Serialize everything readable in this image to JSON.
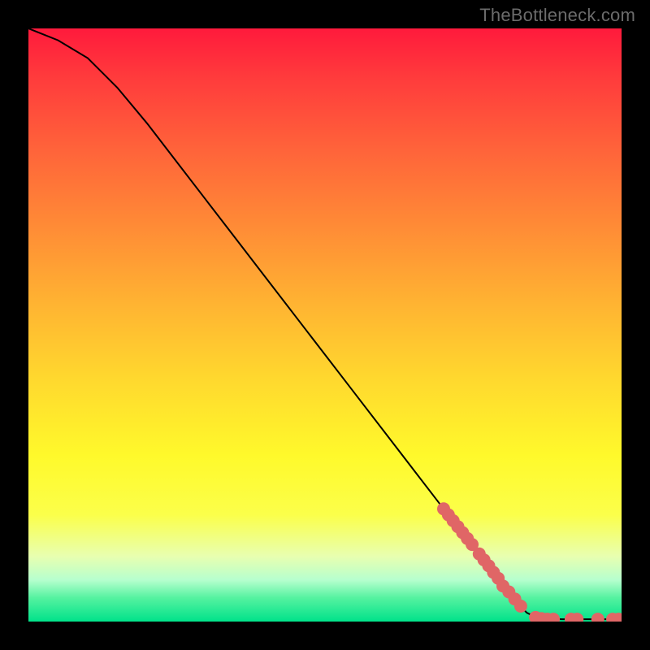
{
  "attribution": "TheBottleneck.com",
  "colors": {
    "dot": "#e06666",
    "curve": "#000000",
    "frame": "#000000"
  },
  "chart_data": {
    "type": "line",
    "title": "",
    "xlabel": "",
    "ylabel": "",
    "xlim": [
      0,
      100
    ],
    "ylim": [
      0,
      100
    ],
    "grid": false,
    "legend": false,
    "curve": [
      {
        "x": 0,
        "y": 100
      },
      {
        "x": 5,
        "y": 98
      },
      {
        "x": 10,
        "y": 95
      },
      {
        "x": 15,
        "y": 90
      },
      {
        "x": 20,
        "y": 84
      },
      {
        "x": 25,
        "y": 77.5
      },
      {
        "x": 30,
        "y": 71
      },
      {
        "x": 35,
        "y": 64.5
      },
      {
        "x": 40,
        "y": 58
      },
      {
        "x": 45,
        "y": 51.5
      },
      {
        "x": 50,
        "y": 45
      },
      {
        "x": 55,
        "y": 38.5
      },
      {
        "x": 60,
        "y": 32
      },
      {
        "x": 65,
        "y": 25.5
      },
      {
        "x": 70,
        "y": 19
      },
      {
        "x": 75,
        "y": 12.5
      },
      {
        "x": 80,
        "y": 6
      },
      {
        "x": 84,
        "y": 1.5
      },
      {
        "x": 86,
        "y": 0.5
      },
      {
        "x": 90,
        "y": 0.4
      },
      {
        "x": 95,
        "y": 0.4
      },
      {
        "x": 100,
        "y": 0.4
      }
    ],
    "highlight_points": [
      {
        "x": 70.0,
        "y": 19.0
      },
      {
        "x": 70.8,
        "y": 18.0
      },
      {
        "x": 71.6,
        "y": 17.0
      },
      {
        "x": 72.4,
        "y": 16.0
      },
      {
        "x": 73.2,
        "y": 15.0
      },
      {
        "x": 74.0,
        "y": 14.0
      },
      {
        "x": 74.8,
        "y": 13.0
      },
      {
        "x": 76.0,
        "y": 11.4
      },
      {
        "x": 76.8,
        "y": 10.4
      },
      {
        "x": 77.6,
        "y": 9.4
      },
      {
        "x": 78.4,
        "y": 8.3
      },
      {
        "x": 79.2,
        "y": 7.3
      },
      {
        "x": 80.0,
        "y": 6.0
      },
      {
        "x": 81.0,
        "y": 5.0
      },
      {
        "x": 82.0,
        "y": 3.8
      },
      {
        "x": 83.0,
        "y": 2.6
      },
      {
        "x": 85.5,
        "y": 0.7
      },
      {
        "x": 86.5,
        "y": 0.5
      },
      {
        "x": 87.5,
        "y": 0.4
      },
      {
        "x": 88.5,
        "y": 0.4
      },
      {
        "x": 91.5,
        "y": 0.4
      },
      {
        "x": 92.5,
        "y": 0.4
      },
      {
        "x": 96.0,
        "y": 0.4
      },
      {
        "x": 98.5,
        "y": 0.4
      },
      {
        "x": 99.5,
        "y": 0.4
      }
    ]
  }
}
